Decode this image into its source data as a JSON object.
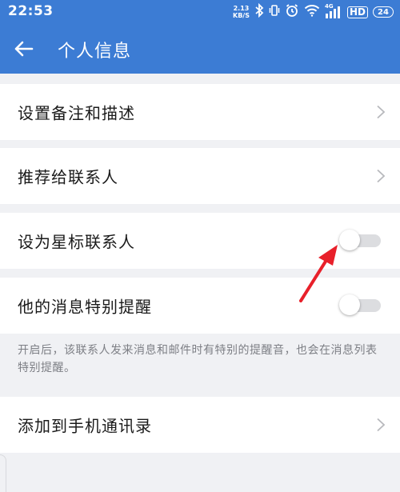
{
  "status_bar": {
    "time": "22:53",
    "net_speed_value": "2.13",
    "net_speed_unit": "KB/S",
    "network_label": "4G",
    "hd_label": "HD",
    "battery_level": "24",
    "icons": [
      "bluetooth-icon",
      "vibrate-icon",
      "alarm-icon",
      "wifi-icon",
      "signal-icon",
      "battery-icon"
    ]
  },
  "app_bar": {
    "title": "个人信息",
    "back_icon": "arrow-left-icon",
    "background_color": "#3c7cd4"
  },
  "settings": {
    "remark_description": "设置备注和描述",
    "recommend_contact": "推荐给联系人",
    "star_contact": "设为星标联系人",
    "star_contact_enabled": false,
    "special_reminder": "他的消息特别提醒",
    "special_reminder_enabled": false,
    "special_reminder_note": "开启后，该联系人发来消息和邮件时有特别的提醒音，也会在消息列表特别提醒。",
    "add_to_contacts": "添加到手机通讯录"
  },
  "annotation": {
    "color": "#e8202a",
    "icon": "red-arrow-annotation"
  }
}
